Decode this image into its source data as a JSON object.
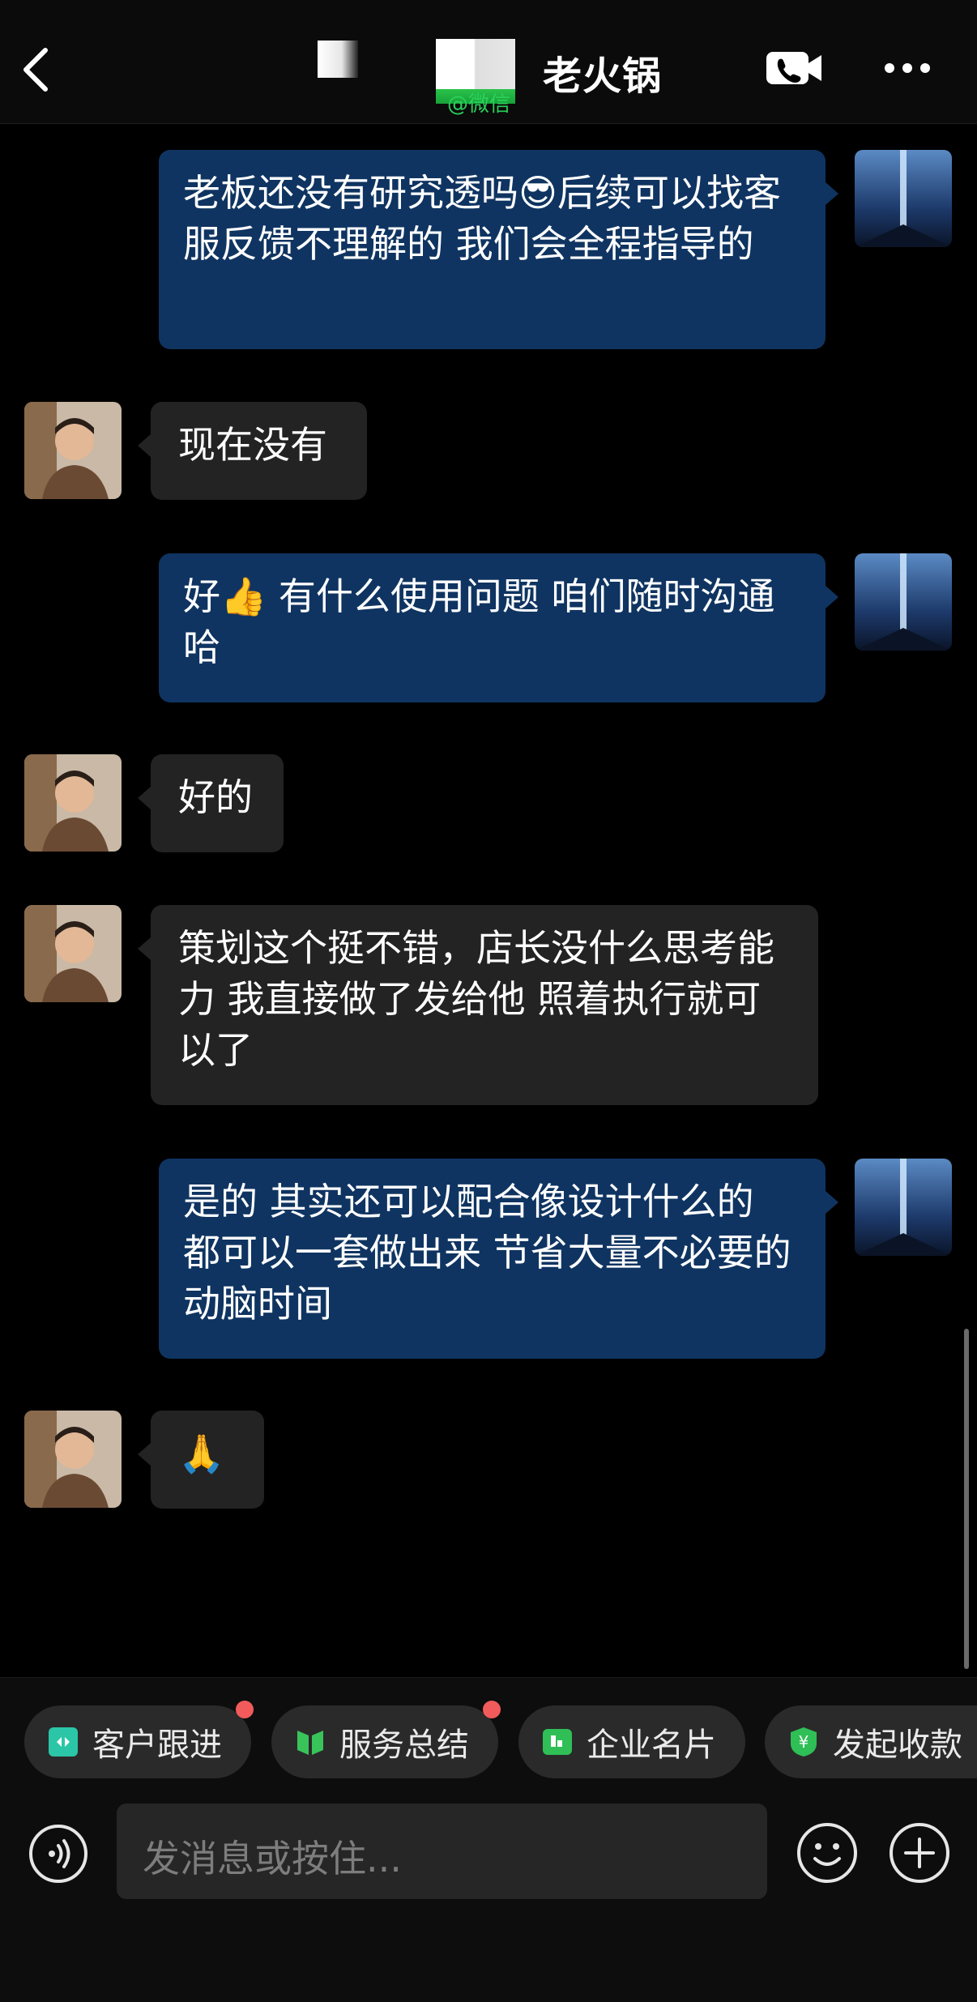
{
  "header": {
    "title": "老火锅",
    "channel_tag": "@微信"
  },
  "messages": [
    {
      "side": "out",
      "text": "老板还没有研究透吗😎后续可以找客服反馈不理解的 我们会全程指导的"
    },
    {
      "side": "in",
      "text": "现在没有"
    },
    {
      "side": "out",
      "text": "好👍 有什么使用问题 咱们随时沟通哈"
    },
    {
      "side": "in",
      "text": "好的"
    },
    {
      "side": "in",
      "text": "策划这个挺不错，店长没什么思考能力 我直接做了发给他 照着执行就可以了"
    },
    {
      "side": "out",
      "text": "是的 其实还可以配合像设计什么的 都可以一套做出来 节省大量不必要的动脑时间"
    },
    {
      "side": "in",
      "text": "🙏"
    }
  ],
  "quick_actions": [
    {
      "label": "客户跟进",
      "icon": "customer-follow-icon",
      "color": "#2bc6a8",
      "badge": true
    },
    {
      "label": "服务总结",
      "icon": "service-summary-icon",
      "color": "#39c45a",
      "badge": true
    },
    {
      "label": "企业名片",
      "icon": "business-card-icon",
      "color": "#2fbf56",
      "badge": false
    },
    {
      "label": "发起收款",
      "icon": "payment-icon",
      "color": "#2fbf56",
      "badge": false
    }
  ],
  "input": {
    "placeholder": "发消息或按住..."
  }
}
